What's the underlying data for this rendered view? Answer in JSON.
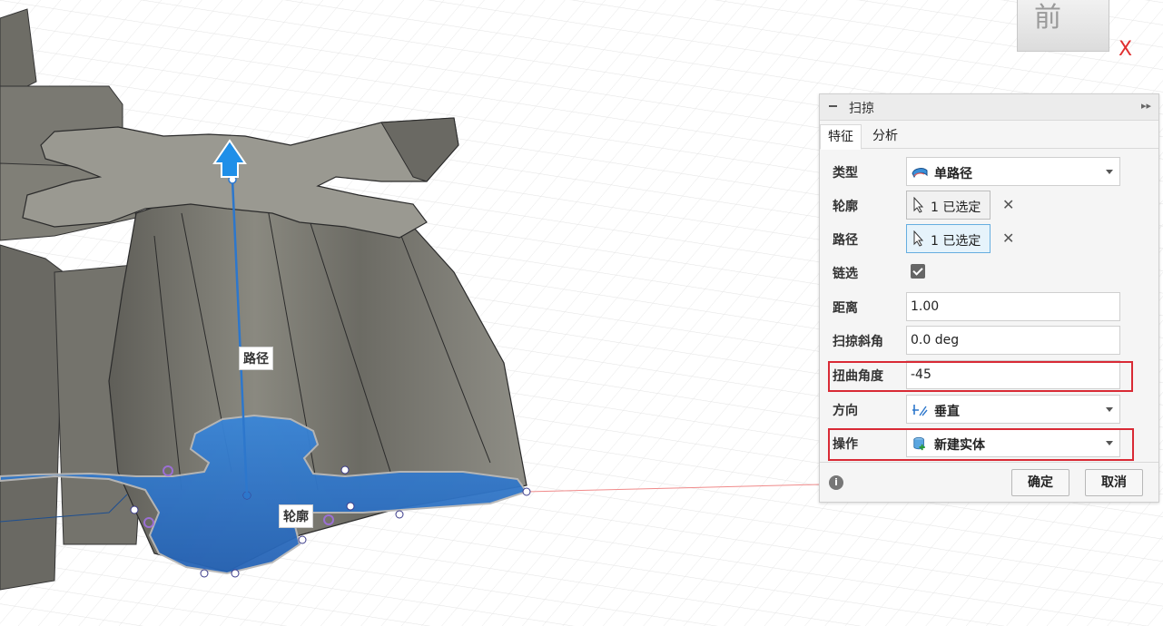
{
  "viewcube": {
    "face_label": "前",
    "axis_label": "X"
  },
  "viewport_tags": {
    "path": "路径",
    "profile": "轮廓"
  },
  "dialog": {
    "title": "扫掠",
    "tabs": [
      "特征",
      "分析"
    ],
    "fields": {
      "type": {
        "label": "类型",
        "value": "单路径",
        "icon": "sweep-single-path-icon"
      },
      "profile": {
        "label": "轮廓",
        "value": "1 已选定",
        "icon": "cursor-select-icon"
      },
      "path": {
        "label": "路径",
        "value": "1 已选定",
        "icon": "cursor-select-icon"
      },
      "chain": {
        "label": "链选",
        "checked": true
      },
      "distance": {
        "label": "距离",
        "value": "1.00"
      },
      "taper": {
        "label": "扫掠斜角",
        "value": "0.0 deg"
      },
      "twist": {
        "label": "扭曲角度",
        "value": "-45"
      },
      "orientation": {
        "label": "方向",
        "value": "垂直",
        "icon": "perpendicular-icon"
      },
      "operation": {
        "label": "操作",
        "value": "新建实体",
        "icon": "new-body-icon"
      }
    },
    "ok_label": "确定",
    "cancel_label": "取消"
  },
  "colors": {
    "highlight": "#d92a35",
    "accent_blue": "#2d77cc",
    "model_gray": "#7d7c74"
  }
}
